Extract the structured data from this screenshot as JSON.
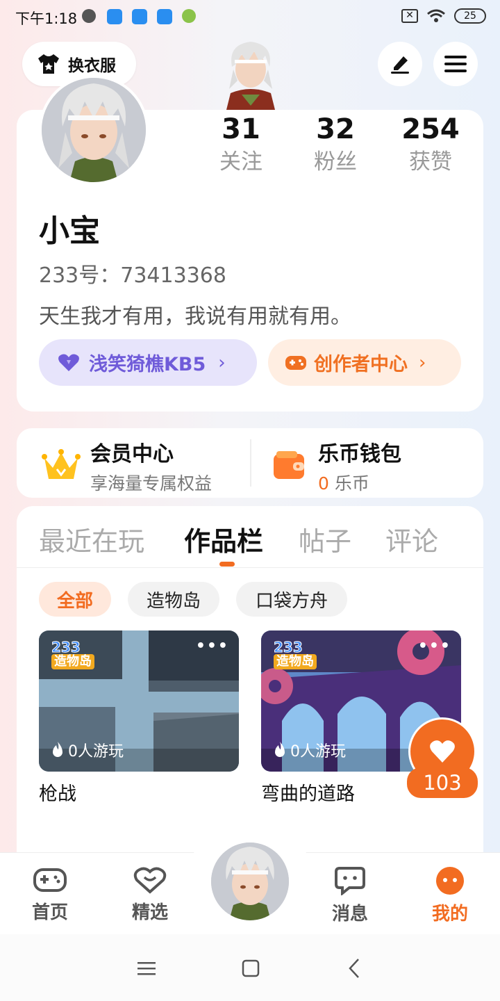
{
  "status_bar": {
    "time": "下午1:18",
    "battery": "25"
  },
  "header": {
    "outfit_label": "换衣服",
    "edit_icon": "pen-icon",
    "menu_icon": "hamburger-icon"
  },
  "profile": {
    "stats": [
      {
        "value": "31",
        "label": "关注"
      },
      {
        "value": "32",
        "label": "粉丝"
      },
      {
        "value": "254",
        "label": "获赞"
      }
    ],
    "username": "小宝",
    "id_line": "233号：73413368",
    "bio": "天生我才有用，我说有用就有用。",
    "guild_chip": "浅笑猗樵KB5",
    "creator_chip": "创作者中心"
  },
  "member": {
    "vip_title": "会员中心",
    "vip_sub": "享海量专属权益",
    "wallet_title": "乐币钱包",
    "wallet_amount": "0",
    "wallet_unit": "乐币"
  },
  "tabs": [
    "最近在玩",
    "作品栏",
    "帖子",
    "评论"
  ],
  "active_tab": "作品栏",
  "filters": [
    "全部",
    "造物岛",
    "口袋方舟"
  ],
  "works": [
    {
      "title": "枪战",
      "plays": "0人游玩",
      "badge_top": "233",
      "badge_bottom": "造物岛"
    },
    {
      "title": "弯曲的道路",
      "plays": "0人游玩",
      "badge_top": "233",
      "badge_bottom": "造物岛"
    }
  ],
  "like_count": "103",
  "bottom_nav": [
    {
      "label": "首页",
      "icon": "gamepad-icon"
    },
    {
      "label": "精选",
      "icon": "heart-chat-icon"
    },
    {
      "label": "消息",
      "icon": "message-icon"
    },
    {
      "label": "我的",
      "icon": "face-icon"
    }
  ],
  "colors": {
    "accent": "#f26c21",
    "purple": "#6f5bd9"
  }
}
